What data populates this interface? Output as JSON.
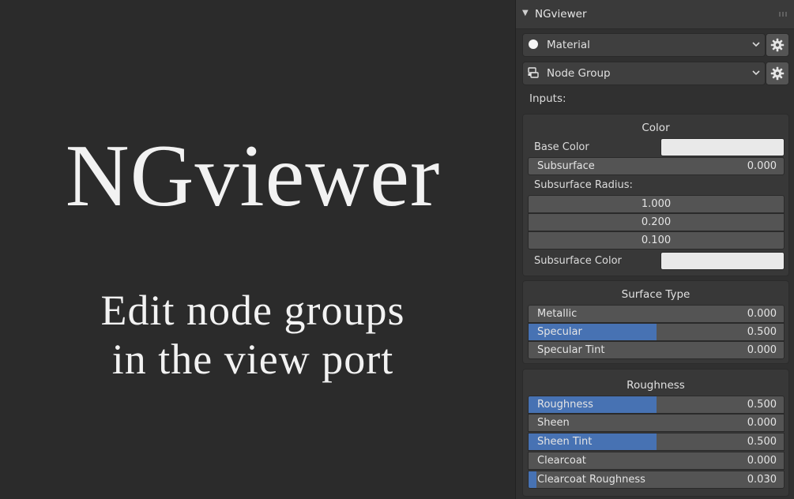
{
  "hero": {
    "title": "NGviewer",
    "subtitle_line1": "Edit node groups",
    "subtitle_line2": "in the view port"
  },
  "panel": {
    "title": "NGviewer",
    "material_dropdown": "Material",
    "nodegroup_dropdown": "Node Group",
    "inputs_label": "Inputs:"
  },
  "groups": {
    "color": {
      "title": "Color",
      "base_color_label": "Base Color",
      "base_color_value": "#e9e9e9",
      "subsurface": {
        "label": "Subsurface",
        "value": "0.000",
        "fill": 0.0
      },
      "subsurface_radius_label": "Subsurface Radius:",
      "radius": [
        "1.000",
        "0.200",
        "0.100"
      ],
      "subsurface_color_label": "Subsurface Color",
      "subsurface_color_value": "#e9e9e9"
    },
    "surface": {
      "title": "Surface Type",
      "items": [
        {
          "label": "Metallic",
          "value": "0.000",
          "fill": 0.0
        },
        {
          "label": "Specular",
          "value": "0.500",
          "fill": 0.5
        },
        {
          "label": "Specular Tint",
          "value": "0.000",
          "fill": 0.0
        }
      ]
    },
    "roughness": {
      "title": "Roughness",
      "items": [
        {
          "label": "Roughness",
          "value": "0.500",
          "fill": 0.5
        },
        {
          "label": "Sheen",
          "value": "0.000",
          "fill": 0.0
        },
        {
          "label": "Sheen Tint",
          "value": "0.500",
          "fill": 0.5
        },
        {
          "label": "Clearcoat",
          "value": "0.000",
          "fill": 0.0
        },
        {
          "label": "Clearcoat Roughness",
          "value": "0.030",
          "fill": 0.03
        }
      ]
    }
  },
  "colors": {
    "accent": "#4772b3",
    "panel_bg": "#303030",
    "field_bg": "#545454"
  },
  "icons": [
    "collapse-arrow-icon",
    "grip-icon",
    "material-sphere-icon",
    "node-group-icon",
    "chevron-down-icon",
    "gear-icon"
  ]
}
